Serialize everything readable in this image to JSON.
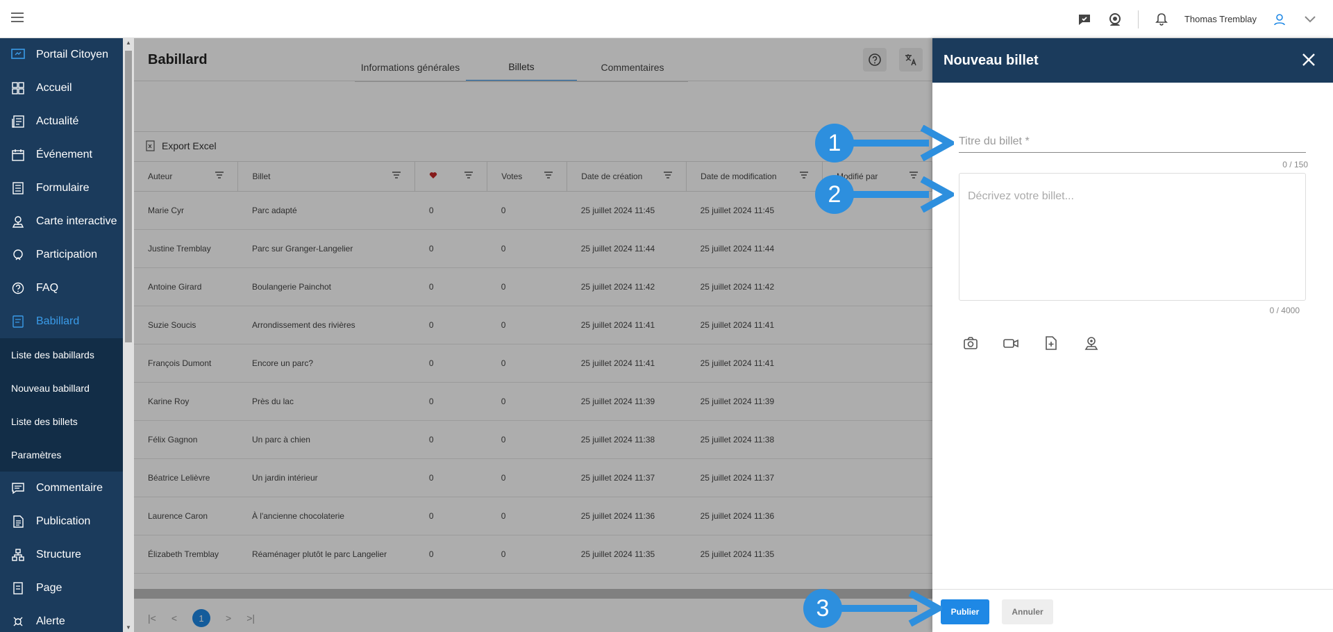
{
  "topbar": {
    "user_name": "Thomas Tremblay"
  },
  "sidebar": {
    "items": [
      {
        "label": "Portail Citoyen",
        "icon": "portal-icon"
      },
      {
        "label": "Accueil",
        "icon": "dashboard-icon"
      },
      {
        "label": "Actualité",
        "icon": "news-icon"
      },
      {
        "label": "Événement",
        "icon": "calendar-icon"
      },
      {
        "label": "Formulaire",
        "icon": "form-icon"
      },
      {
        "label": "Carte interactive",
        "icon": "map-pin-icon"
      },
      {
        "label": "Participation",
        "icon": "participation-icon"
      },
      {
        "label": "FAQ",
        "icon": "question-icon"
      },
      {
        "label": "Babillard",
        "icon": "board-icon"
      }
    ],
    "subitems": [
      {
        "label": "Liste des babillards"
      },
      {
        "label": "Nouveau babillard"
      },
      {
        "label": "Liste des billets"
      },
      {
        "label": "Paramètres"
      }
    ],
    "items2": [
      {
        "label": "Commentaire",
        "icon": "comment-icon"
      },
      {
        "label": "Publication",
        "icon": "publication-icon"
      },
      {
        "label": "Structure",
        "icon": "structure-icon"
      },
      {
        "label": "Page",
        "icon": "page-icon"
      },
      {
        "label": "Alerte",
        "icon": "alert-icon"
      }
    ]
  },
  "main": {
    "title": "Babillard",
    "tabs": [
      "Informations générales",
      "Billets",
      "Commentaires"
    ],
    "export_label": "Export Excel",
    "columns": [
      "Auteur",
      "Billet",
      "",
      "Votes",
      "Date de création",
      "Date de modification",
      "Modifié par"
    ],
    "rows": [
      [
        "Marie Cyr",
        "Parc adapté",
        "0",
        "0",
        "25 juillet 2024 11:45",
        "25 juillet 2024 11:45"
      ],
      [
        "Justine Tremblay",
        "Parc sur Granger-Langelier",
        "0",
        "0",
        "25 juillet 2024 11:44",
        "25 juillet 2024 11:44"
      ],
      [
        "Antoine Girard",
        "Boulangerie Painchot",
        "0",
        "0",
        "25 juillet 2024 11:42",
        "25 juillet 2024 11:42"
      ],
      [
        "Suzie Soucis",
        "Arrondissement des rivières",
        "0",
        "0",
        "25 juillet 2024 11:41",
        "25 juillet 2024 11:41"
      ],
      [
        "François Dumont",
        "Encore un parc?",
        "0",
        "0",
        "25 juillet 2024 11:41",
        "25 juillet 2024 11:41"
      ],
      [
        "Karine Roy",
        "Près du lac",
        "0",
        "0",
        "25 juillet 2024 11:39",
        "25 juillet 2024 11:39"
      ],
      [
        "Félix Gagnon",
        "Un parc à chien",
        "0",
        "0",
        "25 juillet 2024 11:38",
        "25 juillet 2024 11:38"
      ],
      [
        "Béatrice Lelièvre",
        "Un jardin intérieur",
        "0",
        "0",
        "25 juillet 2024 11:37",
        "25 juillet 2024 11:37"
      ],
      [
        "Laurence Caron",
        "À l'ancienne chocolaterie",
        "0",
        "0",
        "25 juillet 2024 11:36",
        "25 juillet 2024 11:36"
      ],
      [
        "Élizabeth Tremblay",
        "Réaménager plutôt le parc Langelier",
        "0",
        "0",
        "25 juillet 2024 11:35",
        "25 juillet 2024 11:35"
      ]
    ],
    "current_page": "1"
  },
  "drawer": {
    "title": "Nouveau billet",
    "title_placeholder": "Titre du billet *",
    "title_count": "0 / 150",
    "desc_placeholder": "Décrivez votre billet...",
    "desc_count": "0 / 4000",
    "publish_label": "Publier",
    "cancel_label": "Annuler"
  },
  "callouts": [
    "1",
    "2",
    "3"
  ],
  "colors": {
    "sidebar_bg": "#1b3b5c",
    "accent": "#1e88e5",
    "callout": "#2d8fde"
  }
}
